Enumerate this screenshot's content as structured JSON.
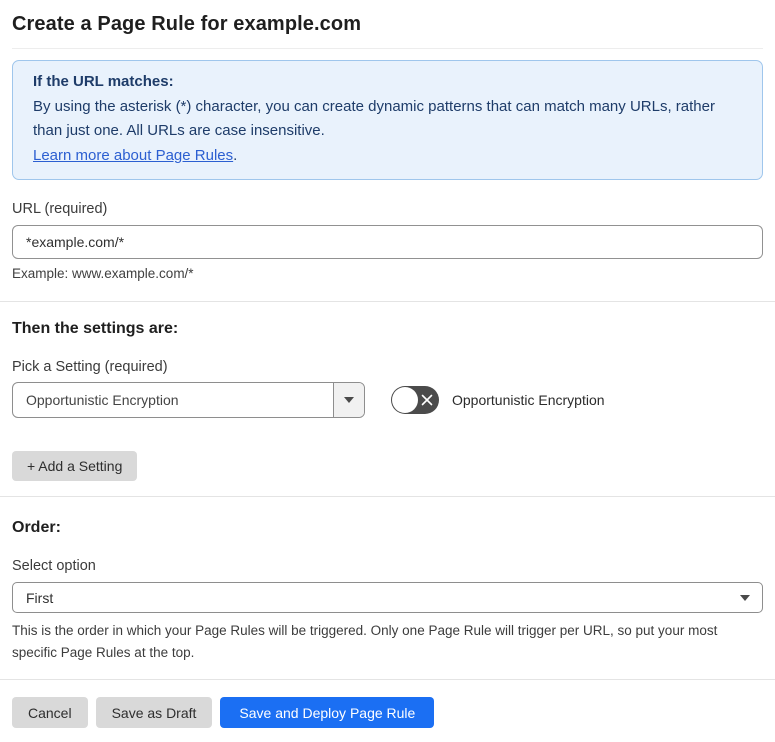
{
  "page": {
    "title": "Create a Page Rule for example.com"
  },
  "callout": {
    "heading": "If the URL matches:",
    "body": "By using the asterisk (*) character, you can create dynamic patterns that can match many URLs, rather than just one. All URLs are case insensitive.",
    "link_label": "Learn more about Page Rules",
    "link_suffix": "."
  },
  "url_field": {
    "label": "URL (required)",
    "value": "*example.com/*",
    "helper": "Example: www.example.com/*"
  },
  "settings": {
    "heading": "Then the settings are:",
    "picker_label": "Pick a Setting (required)",
    "picker_value": "Opportunistic Encryption",
    "toggle_state": "off",
    "toggle_label": "Opportunistic Encryption",
    "add_button_label": "+ Add a Setting"
  },
  "order": {
    "heading": "Order:",
    "select_label": "Select option",
    "select_value": "First",
    "helper": "This is the order in which your Page Rules will be triggered. Only one Page Rule will trigger per URL, so put your most specific Page Rules at the top."
  },
  "footer": {
    "cancel_label": "Cancel",
    "save_draft_label": "Save as Draft",
    "save_deploy_label": "Save and Deploy Page Rule"
  },
  "colors": {
    "accent_blue": "#1b6ff3",
    "callout_bg": "#e9f2fc",
    "callout_border": "#9fc6ec",
    "callout_text": "#1e3c69",
    "link_blue": "#2c5fd1",
    "toggle_off_bg": "#4b4b4b",
    "button_gray": "#d9d9d9"
  }
}
